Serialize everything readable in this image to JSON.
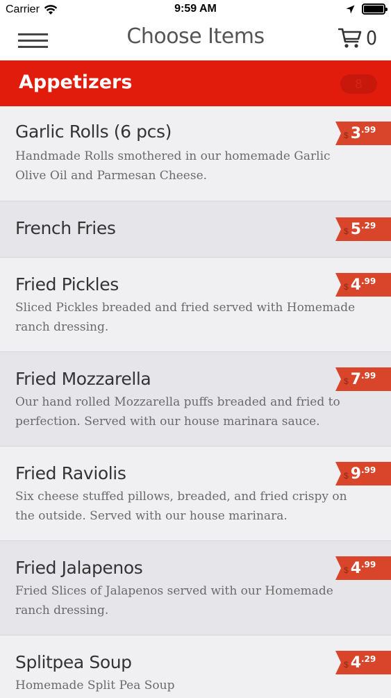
{
  "status_bar": {
    "carrier": "Carrier",
    "time": "9:59 AM"
  },
  "nav": {
    "title": "Choose Items",
    "cart_count": "0"
  },
  "category": {
    "title": "Appetizers",
    "badge": "8"
  },
  "items": [
    {
      "name": "Garlic Rolls (6 pcs)",
      "description": "Handmade Rolls smothered in our homemade Garlic Olive Oil and Parmesan Cheese.",
      "price_currency": "$",
      "price_dollars": "3",
      "price_cents": ".99"
    },
    {
      "name": "French Fries",
      "description": "",
      "price_currency": "$",
      "price_dollars": "5",
      "price_cents": ".29"
    },
    {
      "name": "Fried Pickles",
      "description": "Sliced Pickles breaded and fried served with Homemade ranch dressing.",
      "price_currency": "$",
      "price_dollars": "4",
      "price_cents": ".99"
    },
    {
      "name": "Fried Mozzarella",
      "description": "Our hand rolled Mozzarella puffs breaded and fried to perfection. Served with our house marinara sauce.",
      "price_currency": "$",
      "price_dollars": "7",
      "price_cents": ".99"
    },
    {
      "name": "Fried Raviolis",
      "description": "Six cheese stuffed pillows, breaded, and fried crispy on the outside. Served with our house marinara.",
      "price_currency": "$",
      "price_dollars": "9",
      "price_cents": ".99"
    },
    {
      "name": "Fried Jalapenos",
      "description": "Fried Slices of Jalapenos served with our Homemade ranch dressing.",
      "price_currency": "$",
      "price_dollars": "4",
      "price_cents": ".99"
    },
    {
      "name": "Splitpea Soup",
      "description": "Homemade Split Pea Soup",
      "price_currency": "$",
      "price_dollars": "4",
      "price_cents": ".29"
    }
  ]
}
